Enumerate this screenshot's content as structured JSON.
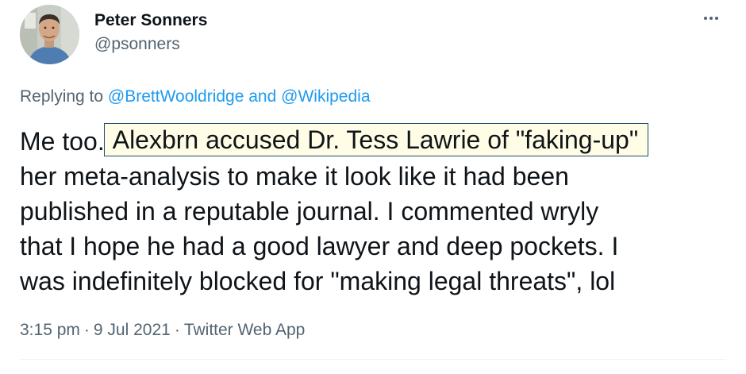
{
  "author": {
    "display_name": "Peter Sonners",
    "handle": "@psonners"
  },
  "more_icon": "more-horizontal-icon",
  "reply": {
    "prefix": "Replying to ",
    "mention1": "@BrettWooldridge",
    "joiner": " and ",
    "mention2": "@Wikipedia"
  },
  "tweet": {
    "line1_before": "Me too.",
    "line1_highlight": "Alexbrn accused Dr. Tess Lawrie of \"faking-up\"",
    "line2": "her meta-analysis to make it look like it had been",
    "line3": "published in a reputable journal. I commented wryly",
    "line4": "that I hope he had a good lawyer and deep pockets. I",
    "line5": "was indefinitely blocked for \"making legal threats\", lol"
  },
  "meta": {
    "time": "3:15 pm",
    "date": "9 Jul 2021",
    "source": "Twitter Web App",
    "separator": "·"
  },
  "colors": {
    "accent": "#1d9bf0",
    "secondary_text": "#536471",
    "primary_text": "#0f1419",
    "highlight_fill": "#fffde5",
    "highlight_border": "#1d4f6e"
  }
}
